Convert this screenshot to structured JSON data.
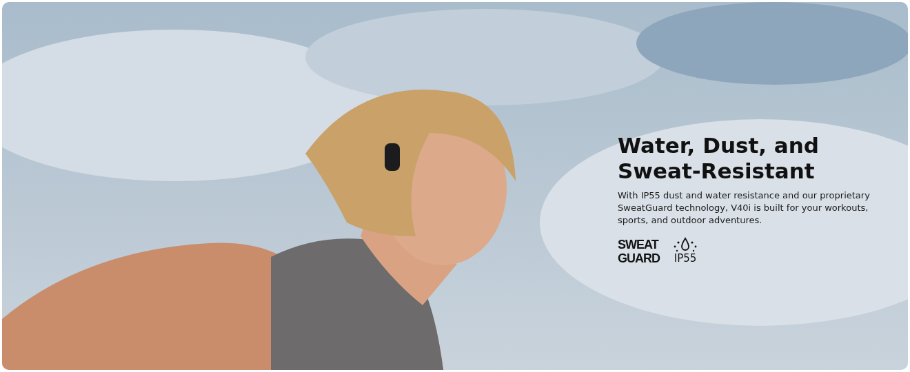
{
  "banner": {
    "kind": "picture",
    "heading": [
      "Water, Dust, and",
      "Sweat-Resistant"
    ],
    "description": "With IP55 dust and water resistance and our proprietary SweatGuard technology, V40i is built for your workouts, sports, and outdoor adventures.",
    "badges": [
      {
        "kind": "sweatguard",
        "lines": [
          "SWEAT",
          "GUARD"
        ]
      },
      {
        "kind": "ip",
        "lines": [
          "IP55"
        ]
      }
    ]
  }
}
